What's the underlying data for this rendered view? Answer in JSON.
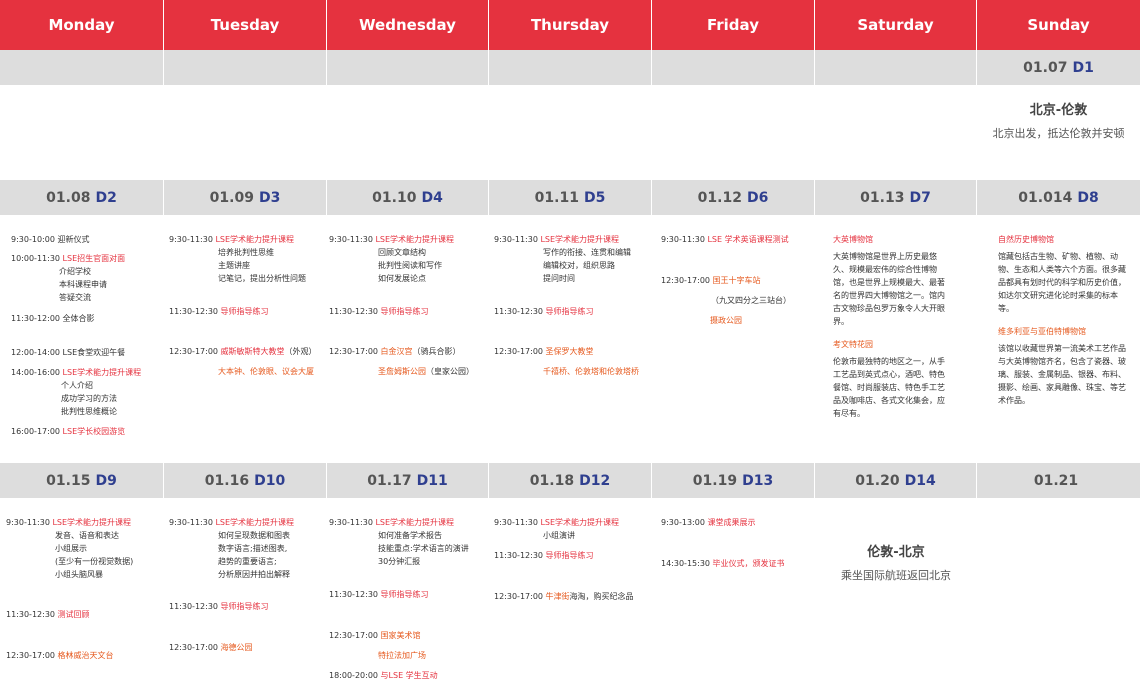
{
  "weekdays": [
    "Monday",
    "Tuesday",
    "Wednesday",
    "Thursday",
    "Friday",
    "Saturday",
    "Sunday"
  ],
  "band1": [
    "",
    "",
    "",
    "",
    "",
    "",
    ""
  ],
  "sunday1": {
    "date": "01.07",
    "day": "D1",
    "title": "北京-伦敦",
    "desc": "北京出发，抵达伦敦并安顿"
  },
  "band2": [
    {
      "date": "01.08",
      "day": "D2"
    },
    {
      "date": "01.09",
      "day": "D3"
    },
    {
      "date": "01.10",
      "day": "D4"
    },
    {
      "date": "01.11",
      "day": "D5"
    },
    {
      "date": "01.12",
      "day": "D6"
    },
    {
      "date": "01.13",
      "day": "D7"
    },
    {
      "date": "01.014",
      "day": "D8"
    }
  ],
  "band3": [
    {
      "date": "01.15",
      "day": "D9"
    },
    {
      "date": "01.16",
      "day": "D10"
    },
    {
      "date": "01.17",
      "day": "D11"
    },
    {
      "date": "01.18",
      "day": "D12"
    },
    {
      "date": "01.19",
      "day": "D13"
    },
    {
      "date": "01.20",
      "day": "D14"
    },
    {
      "date": "01.21",
      "day": ""
    }
  ],
  "week2": {
    "mon": [
      {
        "time": "9:30-10:00",
        "title": "迎新仪式",
        "lines": []
      },
      {
        "time": "10:00-11:30",
        "title": "LSE招生官面对面",
        "lines": [
          "介绍学校",
          "本科课程申请",
          "答疑交流"
        ]
      },
      {
        "time": "11:30-12:00",
        "title": "全体合影",
        "lines": []
      },
      {
        "time": "12:00-14:00",
        "title": "LSE食堂欢迎午餐",
        "lines": []
      },
      {
        "time": "14:00-16:00",
        "title": "LSE学术能力提升课程",
        "lines": [
          "个人介绍",
          "成功学习的方法",
          "批判性思维概论"
        ]
      },
      {
        "time": "16:00-17:00",
        "title": "LSE学长校园游览",
        "lines": []
      }
    ],
    "tue": [
      {
        "time": "9:30-11:30",
        "title": "LSE学术能力提升课程",
        "lines": [
          "培养批判性思维",
          "主题讲座",
          "记笔记，提出分析性问题"
        ]
      },
      {
        "time": "11:30-12:30",
        "title": "导师指导练习",
        "lines": []
      },
      {
        "time": "12:30-17:00",
        "title": "威斯敏斯特大教堂",
        "suffix": "（外观）",
        "lines": []
      },
      {
        "time": "",
        "title": "大本钟、伦敦眼、议会大厦",
        "lines": []
      }
    ],
    "wed": [
      {
        "time": "9:30-11:30",
        "title": "LSE学术能力提升课程",
        "lines": [
          "回顾文章结构",
          "批判性阅读和写作",
          "如何发展论点"
        ]
      },
      {
        "time": "11:30-12:30",
        "title": "导师指导练习",
        "lines": []
      },
      {
        "time": "12:30-17:00",
        "title": "白金汉宫",
        "suffix": "（骑兵合影）",
        "lines": []
      },
      {
        "time": "",
        "title": "圣詹姆斯公园",
        "suffix": "（皇家公园）",
        "lines": []
      }
    ],
    "thu": [
      {
        "time": "9:30-11:30",
        "title": "LSE学术能力提升课程",
        "lines": [
          "写作的衔接、连贯和编辑",
          "编辑校对，组织思路",
          "提问时间"
        ]
      },
      {
        "time": "11:30-12:30",
        "title": "导师指导练习",
        "lines": []
      },
      {
        "time": "12:30-17:00",
        "title": "圣保罗大教堂",
        "lines": []
      },
      {
        "time": "",
        "title": "千禧桥、伦敦塔和伦敦塔桥",
        "lines": []
      }
    ],
    "fri": [
      {
        "time": "9:30-11:30",
        "title": "LSE 学术英语课程测试",
        "lines": []
      },
      {
        "time": "12:30-17:00",
        "title": "国王十字车站",
        "lines": []
      },
      {
        "time": "",
        "title": "",
        "plain": "（九又四分之三站台）",
        "lines": []
      },
      {
        "time": "",
        "title": "摄政公园",
        "lines": []
      }
    ],
    "sat": [
      {
        "title": "大英博物馆",
        "text": "大英博物馆是世界上历史最悠久、规模最宏伟的综合性博物馆，也是世界上规模最大、最著名的世界四大博物馆之一。馆内古文物珍品包罗万象令人大开眼界。"
      },
      {
        "title": "考文特花园",
        "text": "伦敦市最独特的地区之一，从手工艺品到英式点心，酒吧、特色餐馆、时尚服装店、特色手工艺品及咖啡店、各式文化集会，应有尽有。"
      }
    ],
    "sun": [
      {
        "title": "自然历史博物馆",
        "text": "馆藏包括古生物、矿物、植物、动物、生态和人类等六个方面。很多藏品都具有划时代的科学和历史价值，如达尔文研究进化论时采集的标本等。"
      },
      {
        "title": "维多利亚与亚伯特博物馆",
        "text": "该馆以收藏世界第一流美术工艺作品与大英博物馆齐名，包含了瓷器、玻璃、服装、金属制品、银器、布料、摄影、绘画、家具雕像、珠宝、等艺术作品。"
      }
    ]
  },
  "week3": {
    "mon": [
      {
        "time": "9:30-11:30",
        "title": "LSE学术能力提升课程",
        "lines": [
          "发音、语音和表达",
          "小组展示",
          "(至少有一份视觉数据)",
          "小组头脑风暴"
        ]
      },
      {
        "time": "11:30-12:30",
        "title": "测试回顾",
        "lines": []
      },
      {
        "time": "12:30-17:00",
        "title": "格林威治天文台",
        "lines": []
      }
    ],
    "tue": [
      {
        "time": "9:30-11:30",
        "title": "LSE学术能力提升课程",
        "lines": [
          "如何呈现数据和图表",
          "数字语言;描述图表,",
          "趋势的重要语言;",
          "分析原因并拍出解释"
        ]
      },
      {
        "time": "11:30-12:30",
        "title": "导师指导练习",
        "lines": []
      },
      {
        "time": "12:30-17:00",
        "title": "海德公园",
        "lines": []
      }
    ],
    "wed": [
      {
        "time": "9:30-11:30",
        "title": "LSE学术能力提升课程",
        "lines": [
          "如何准备学术报告",
          "技能重点:学术语言的演讲",
          "30分钟汇报"
        ]
      },
      {
        "time": "11:30-12:30",
        "title": "导师指导练习",
        "lines": []
      },
      {
        "time": "12:30-17:00",
        "title": "国家美术馆",
        "lines": []
      },
      {
        "time": "",
        "title": "特拉法加广场",
        "lines": []
      },
      {
        "time": "18:00-20:00",
        "title": "与LSE 学生互动",
        "lines": []
      }
    ],
    "thu": [
      {
        "time": "9:30-11:30",
        "title": "LSE学术能力提升课程",
        "lines": [
          "小组演讲"
        ]
      },
      {
        "time": "11:30-12:30",
        "title": "导师指导练习",
        "lines": []
      },
      {
        "time": "12:30-17:00",
        "title": "牛津街",
        "suffix": "海淘，购买纪念品",
        "lines": []
      }
    ],
    "fri": [
      {
        "time": "9:30-13:00",
        "title": "课堂成果展示",
        "lines": []
      },
      {
        "time": "14:30-15:30",
        "title": "毕业仪式，颁发证书",
        "lines": []
      }
    ],
    "sat": {
      "title": "伦敦-北京",
      "desc": "乘坐国际航班返回北京"
    }
  },
  "colors": {
    "header": "#e5323f",
    "band": "#dddddd",
    "day": "#2f3f8f",
    "red": "#e5323f",
    "orange": "#e65a1f"
  }
}
